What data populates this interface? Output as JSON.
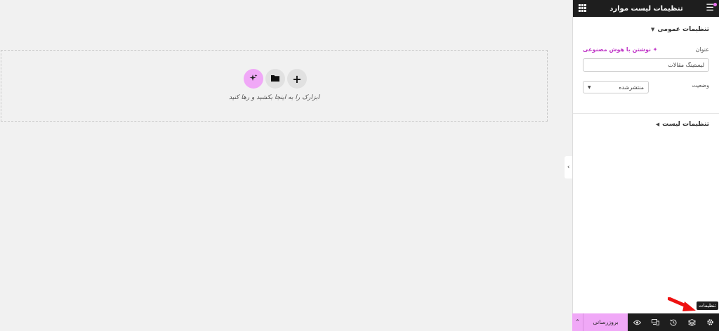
{
  "canvas": {
    "hint": "ابزارک را به اینجا بکشید و رها کنید",
    "buttons": {
      "ai_icon": "sparkle-icon",
      "folder_icon": "folder-icon",
      "add_label": "+"
    }
  },
  "panel": {
    "title": "تنظیمات لیست موارد",
    "general_section": {
      "heading": "تنظیمات عمومی",
      "title_label": "عنوان",
      "ai_link": "نوشتن با هوش مصنوعی",
      "title_value": "لیستینگ مقالات",
      "status_label": "وضعیت",
      "status_value": "منتشرشده"
    },
    "list_section": {
      "heading": "تنظیمات لیست"
    }
  },
  "footer": {
    "publish_label": "بروزرسانی",
    "tooltip": "تنظیمات",
    "icons": [
      "eye-icon",
      "responsive-icon",
      "history-icon",
      "layers-icon",
      "gear-icon"
    ]
  },
  "colors": {
    "accent": "#f0a8f7",
    "ai_link": "#c036c7",
    "dark": "#1e1e1e"
  }
}
